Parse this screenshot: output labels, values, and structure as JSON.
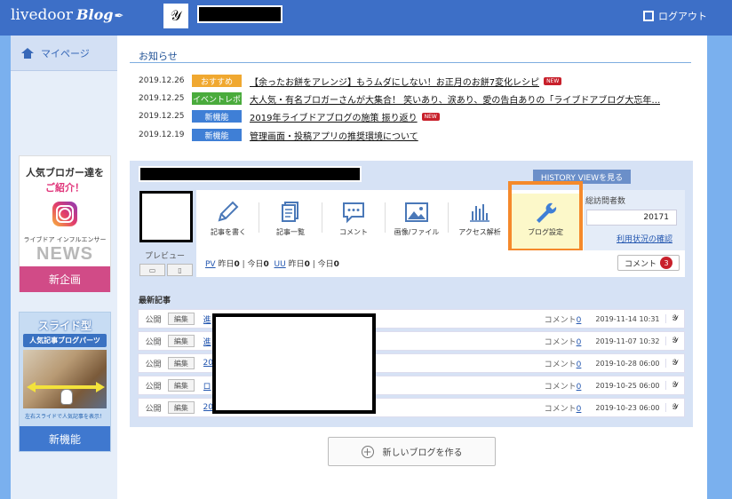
{
  "header": {
    "logo_text": "livedoor",
    "logo_blog": "Blog",
    "logout_label": "ログアウト"
  },
  "sidebar": {
    "mypage_label": "マイページ",
    "banner1": {
      "line1": "人気ブロガー達を",
      "line2": "ご紹介！",
      "sub": "ライブドア インフルエンサー",
      "news": "NEWS",
      "button": "新企画"
    },
    "banner2": {
      "line1": "スライド型",
      "line2": "人気記事ブログパーツ",
      "caption": "左右スライドで人気記事を表示！",
      "button": "新機能"
    }
  },
  "news": {
    "heading": "お知らせ",
    "items": [
      {
        "date": "2019.12.26",
        "tag": "おすすめ",
        "tag_color": "#f0a830",
        "title": "【余ったお餅をアレンジ】もうムダにしない！お正月のお餅7変化レシピ",
        "new": "NEW"
      },
      {
        "date": "2019.12.25",
        "tag": "イベントレポ",
        "tag_color": "#4aab3c",
        "title": "大人気・有名ブロガーさんが大集合！ 笑いあり、涙あり、愛の告白ありの「ライブドアブログ大忘年…",
        "new": ""
      },
      {
        "date": "2019.12.25",
        "tag": "新機能",
        "tag_color": "#3f7fd6",
        "title": "2019年ライブドアブログの施策 振り返り",
        "new": "NEW"
      },
      {
        "date": "2019.12.19",
        "tag": "新機能",
        "tag_color": "#3f7fd6",
        "title": "管理画面・投稿アプリの推奨環境について",
        "new": ""
      }
    ]
  },
  "blog": {
    "history_button": "HISTORY VIEWを見る",
    "preview_label": "プレビュー",
    "tools": [
      {
        "label": "記事を書く",
        "icon": "pencil-icon"
      },
      {
        "label": "記事一覧",
        "icon": "document-list-icon"
      },
      {
        "label": "コメント",
        "icon": "comment-icon"
      },
      {
        "label": "画像/ファイル",
        "icon": "image-icon"
      },
      {
        "label": "アクセス解析",
        "icon": "bar-chart-icon"
      },
      {
        "label": "ブログ設定",
        "icon": "wrench-icon"
      }
    ],
    "visits_label": "総訪問者数",
    "visits_value": "20171",
    "usage_link": "利用状況の確認",
    "stats": {
      "pv": "PV",
      "uu": "UU",
      "yesterday": "昨日",
      "today": "今日",
      "pv_yesterday": "0",
      "pv_today": "0",
      "uu_yesterday": "0",
      "uu_today": "0"
    },
    "comment_button": "コメント",
    "comment_count": "3",
    "accent_color": "#f5892b"
  },
  "recent": {
    "heading": "最新記事",
    "status_label": "公開",
    "edit_label": "編集",
    "comment_label": "コメント",
    "posts": [
      {
        "title": "進",
        "comments": "0",
        "date": "2019-11-14 10:31"
      },
      {
        "title": "進",
        "comments": "0",
        "date": "2019-11-07 10:32"
      },
      {
        "title": "20",
        "comments": "0",
        "date": "2019-10-28 06:00"
      },
      {
        "title": "ロ",
        "comments": "0",
        "date": "2019-10-25 06:00"
      },
      {
        "title": "20",
        "comments": "0",
        "date": "2019-10-23 06:00"
      }
    ]
  },
  "new_blog_button": "新しいブログを作る"
}
